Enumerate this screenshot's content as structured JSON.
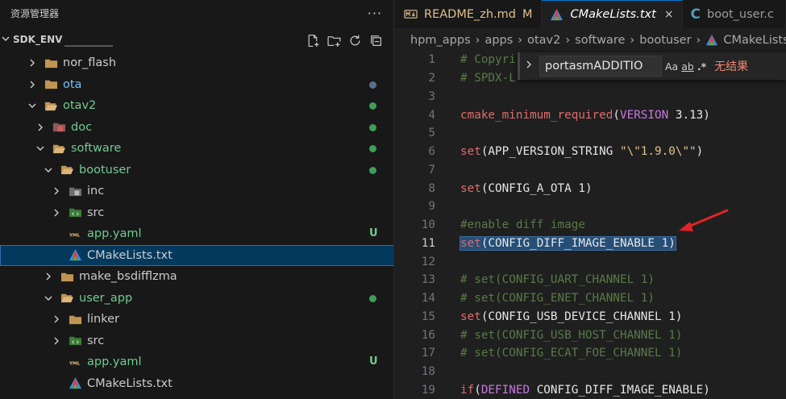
{
  "sidebar": {
    "title": "资源管理器",
    "more_label": "···",
    "workspace": "SDK_ENV",
    "tree": [
      {
        "label": "nor_flash",
        "depth": 1,
        "expanded": false,
        "icon": "folder-icon",
        "color": "normal",
        "badge": ""
      },
      {
        "label": "ota",
        "depth": 1,
        "expanded": false,
        "icon": "folder-icon",
        "color": "blue",
        "badge": "dot-gray"
      },
      {
        "label": "otav2",
        "depth": 1,
        "expanded": true,
        "icon": "folder-open-icon",
        "color": "green",
        "badge": "dot-green"
      },
      {
        "label": "doc",
        "depth": 2,
        "expanded": false,
        "icon": "doc-folder-icon",
        "color": "green",
        "badge": "dot-green"
      },
      {
        "label": "software",
        "depth": 2,
        "expanded": true,
        "icon": "folder-open-icon",
        "color": "green",
        "badge": "dot-green"
      },
      {
        "label": "bootuser",
        "depth": 3,
        "expanded": true,
        "icon": "folder-open-icon",
        "color": "green",
        "badge": "dot-green"
      },
      {
        "label": "inc",
        "depth": 4,
        "expanded": false,
        "icon": "include-folder-icon",
        "color": "normal",
        "badge": ""
      },
      {
        "label": "src",
        "depth": 4,
        "expanded": false,
        "icon": "src-folder-icon",
        "color": "normal",
        "badge": ""
      },
      {
        "label": "app.yaml",
        "depth": 4,
        "expanded": null,
        "icon": "yaml-file-icon",
        "color": "green",
        "badge": "U"
      },
      {
        "label": "CMakeLists.txt",
        "depth": 4,
        "expanded": null,
        "icon": "cmake-file-icon",
        "color": "normal",
        "badge": "",
        "selected": true
      },
      {
        "label": "make_bsdifflzma",
        "depth": 3,
        "expanded": false,
        "icon": "folder-icon",
        "color": "normal",
        "badge": ""
      },
      {
        "label": "user_app",
        "depth": 3,
        "expanded": true,
        "icon": "folder-open-icon",
        "color": "green",
        "badge": "dot-green"
      },
      {
        "label": "linker",
        "depth": 4,
        "expanded": false,
        "icon": "folder-icon",
        "color": "normal",
        "badge": ""
      },
      {
        "label": "src",
        "depth": 4,
        "expanded": false,
        "icon": "src-folder-icon",
        "color": "normal",
        "badge": ""
      },
      {
        "label": "app.yaml",
        "depth": 4,
        "expanded": null,
        "icon": "yaml-file-icon",
        "color": "green",
        "badge": "U"
      },
      {
        "label": "CMakeLists.txt",
        "depth": 4,
        "expanded": null,
        "icon": "cmake-file-icon",
        "color": "normal",
        "badge": ""
      }
    ]
  },
  "tabs": [
    {
      "label": "README_zh.md",
      "modified": "M",
      "icon": "markdown-icon",
      "active": false
    },
    {
      "label": "CMakeLists.txt",
      "modified": "",
      "icon": "cmake-file-icon",
      "active": true,
      "close": "×"
    },
    {
      "label": "boot_user.c",
      "modified": "",
      "icon": "c-file-icon",
      "active": false
    }
  ],
  "breadcrumb": [
    "hpm_apps",
    "apps",
    "otav2",
    "software",
    "bootuser",
    "CMakeLists.txt"
  ],
  "find": {
    "query": "portasmADDITIO",
    "options": [
      "Aa",
      "ab",
      ".*"
    ],
    "result": "无结果"
  },
  "code": [
    {
      "n": "1",
      "parts": [
        [
          "comment",
          "# Copyri"
        ]
      ]
    },
    {
      "n": "2",
      "parts": [
        [
          "comment",
          "# SPDX-L"
        ]
      ]
    },
    {
      "n": "3",
      "parts": []
    },
    {
      "n": "4",
      "parts": [
        [
          "fn",
          "cmake_minimum_required"
        ],
        [
          "plain",
          "("
        ],
        [
          "kw",
          "VERSION"
        ],
        [
          "plain",
          " 3.13)"
        ]
      ]
    },
    {
      "n": "5",
      "parts": []
    },
    {
      "n": "6",
      "parts": [
        [
          "fn",
          "set"
        ],
        [
          "plain",
          "(APP_VERSION_STRING "
        ],
        [
          "str",
          "\"\\\"1.9.0\\\"\""
        ],
        [
          "plain",
          ")"
        ]
      ]
    },
    {
      "n": "7",
      "parts": []
    },
    {
      "n": "8",
      "parts": [
        [
          "fn",
          "set"
        ],
        [
          "plain",
          "(CONFIG_A_OTA 1)"
        ]
      ]
    },
    {
      "n": "9",
      "parts": []
    },
    {
      "n": "10",
      "parts": [
        [
          "comment",
          "#enable diff image"
        ]
      ]
    },
    {
      "n": "11",
      "parts": [
        [
          "fn",
          "set"
        ],
        [
          "plain",
          "(CONFIG_DIFF_IMAGE_ENABLE 1)"
        ]
      ],
      "highlight": true
    },
    {
      "n": "12",
      "parts": []
    },
    {
      "n": "13",
      "parts": [
        [
          "comment",
          "# set(CONFIG_UART_CHANNEL 1)"
        ]
      ]
    },
    {
      "n": "14",
      "parts": [
        [
          "comment",
          "# set(CONFIG_ENET_CHANNEL 1)"
        ]
      ]
    },
    {
      "n": "15",
      "parts": [
        [
          "fn",
          "set"
        ],
        [
          "plain",
          "(CONFIG_USB_DEVICE_CHANNEL 1)"
        ]
      ]
    },
    {
      "n": "16",
      "parts": [
        [
          "comment",
          "# set(CONFIG_USB_HOST_CHANNEL 1)"
        ]
      ]
    },
    {
      "n": "17",
      "parts": [
        [
          "comment",
          "# set(CONFIG_ECAT_FOE_CHANNEL 1)"
        ]
      ]
    },
    {
      "n": "18",
      "parts": []
    },
    {
      "n": "19",
      "parts": [
        [
          "fn",
          "if"
        ],
        [
          "plain",
          "("
        ],
        [
          "kw",
          "DEFINED"
        ],
        [
          "plain",
          " CONFIG_DIFF_IMAGE_ENABLE)"
        ]
      ]
    }
  ],
  "colors": {
    "accent": "#0078d4",
    "git_added": "#73c991",
    "git_modified": "#e2c08d",
    "error": "#f48771",
    "annotation": "#e02424"
  }
}
